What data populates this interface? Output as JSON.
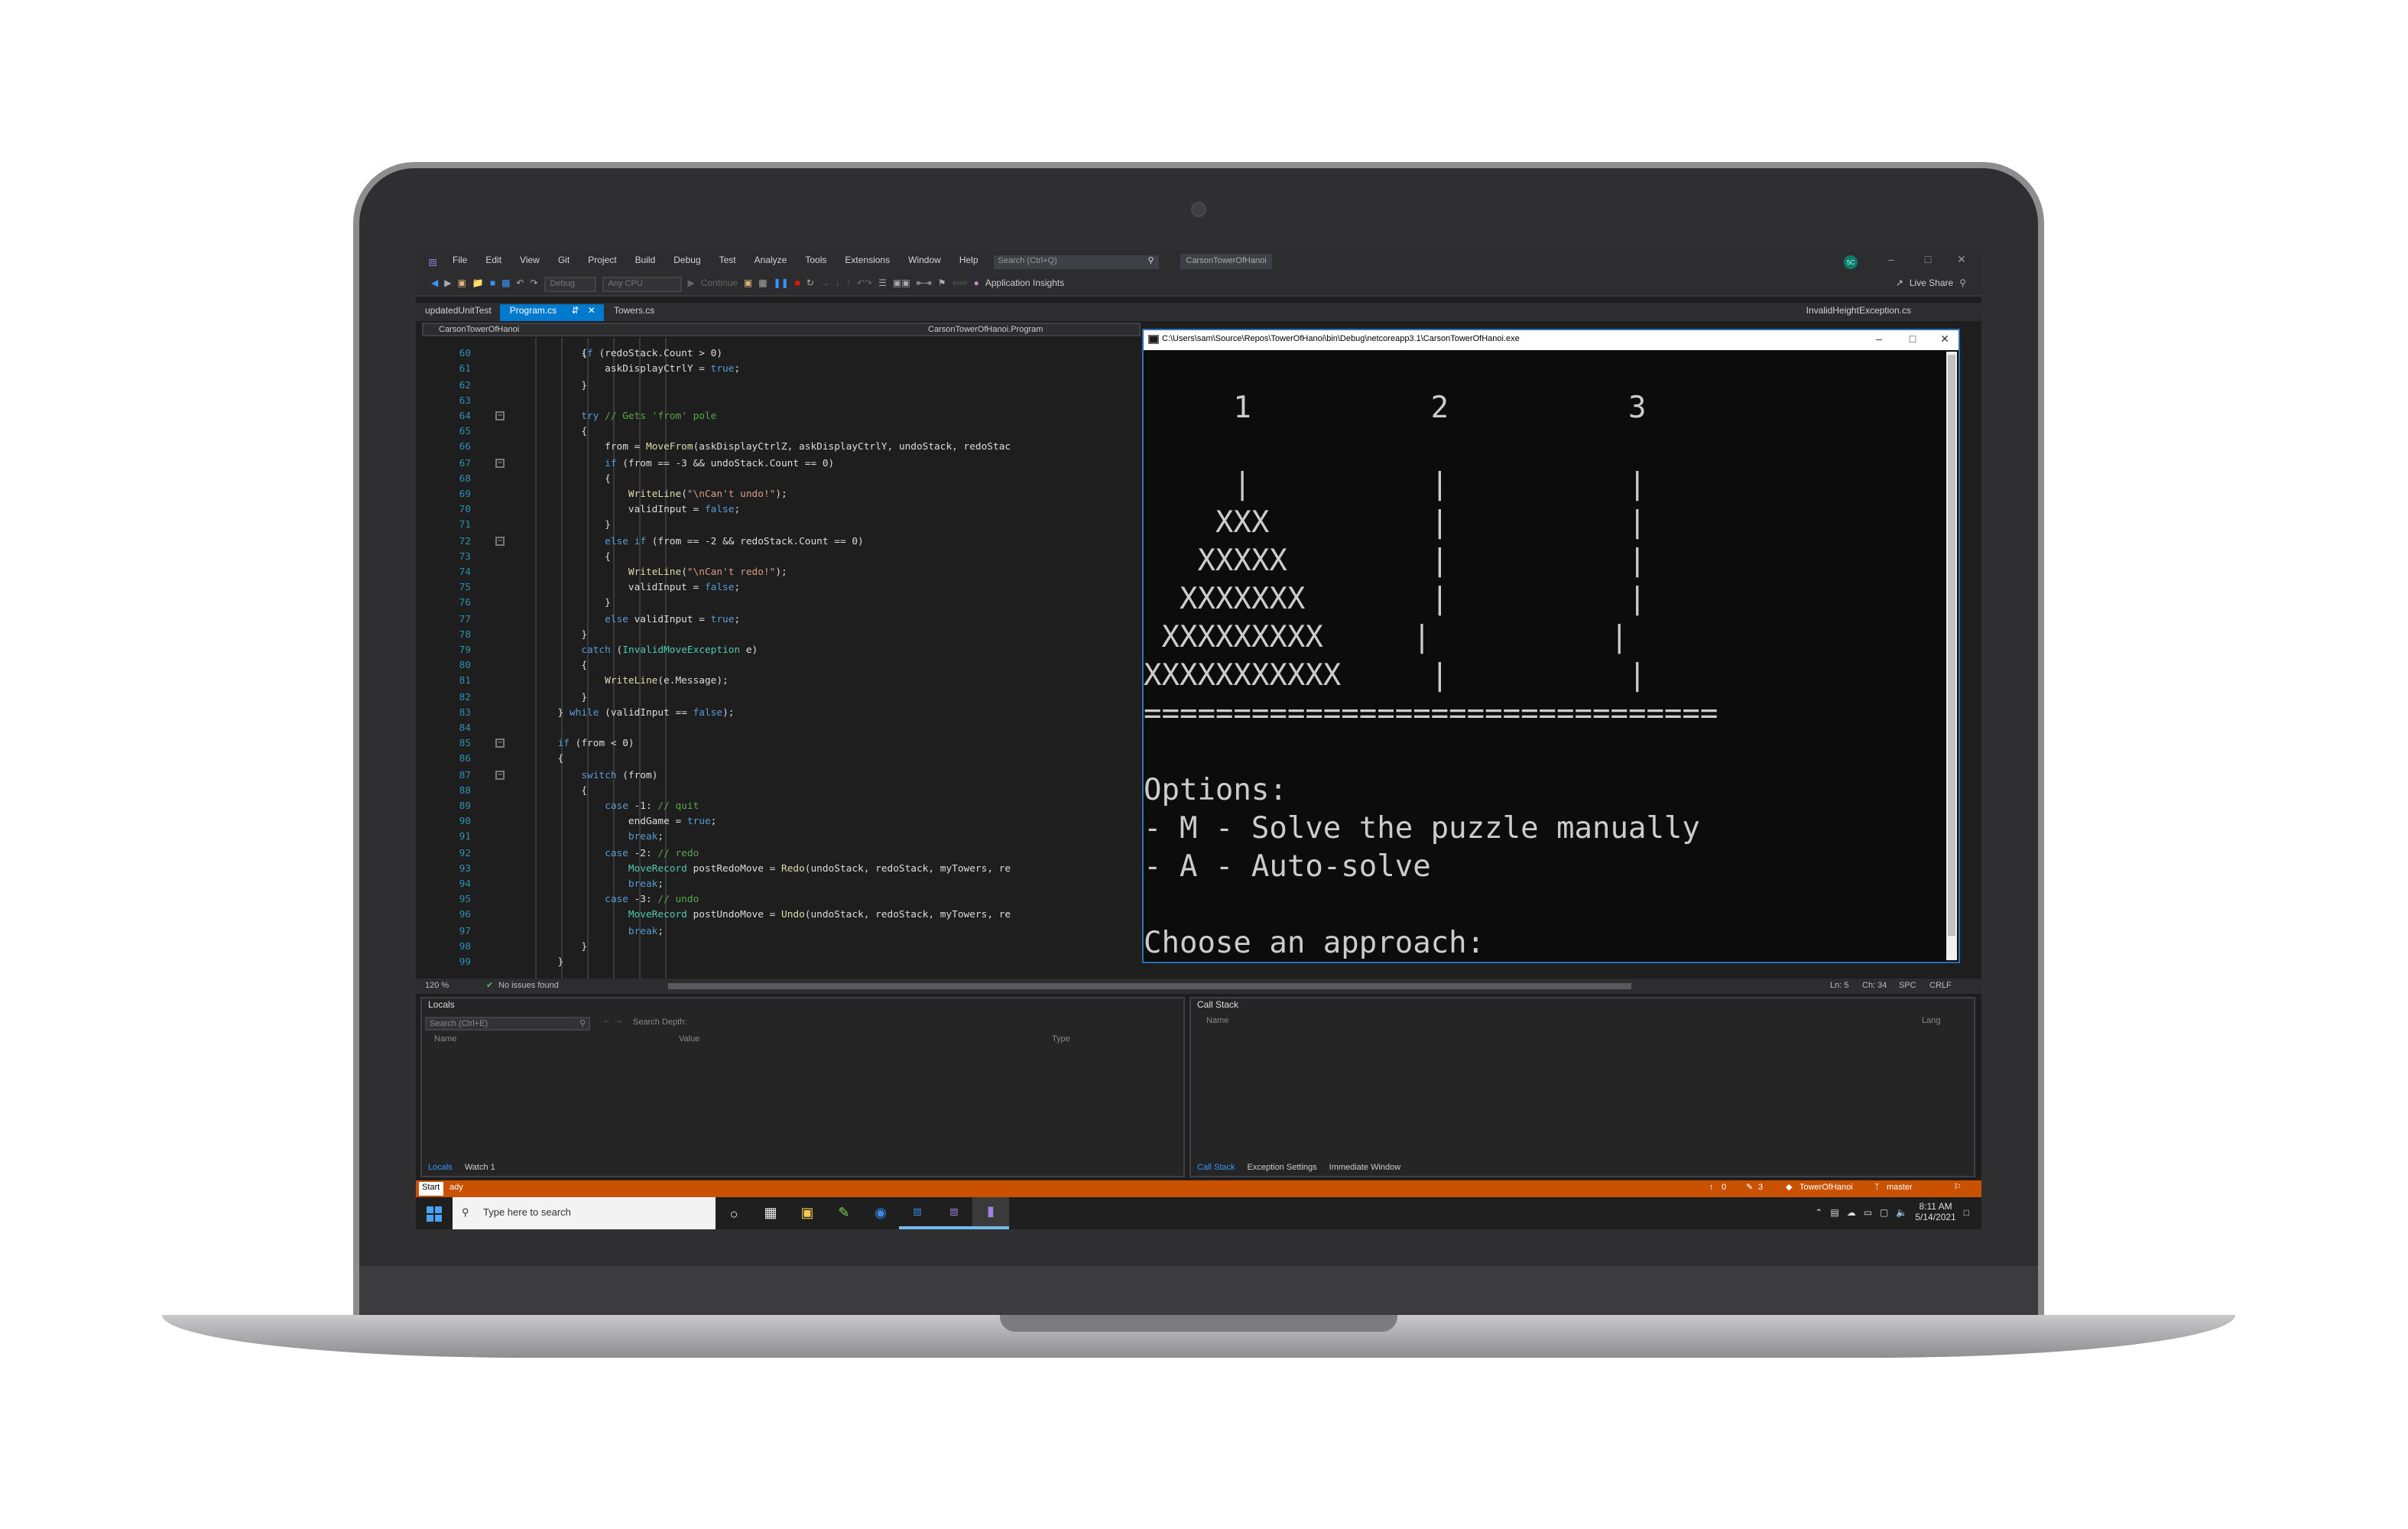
{
  "menubar": {
    "items": [
      "File",
      "Edit",
      "View",
      "Git",
      "Project",
      "Build",
      "Debug",
      "Test",
      "Analyze",
      "Tools",
      "Extensions",
      "Window",
      "Help"
    ],
    "search_placeholder": "Search (Ctrl+Q)",
    "solution_name": "CarsonTowerOfHanoi",
    "avatar_initials": "SC"
  },
  "toolbar": {
    "config_value": "Debug",
    "platform_value": "Any CPU",
    "continue_label": "Continue",
    "app_insights_label": "Application Insights",
    "live_share_label": "Live Share"
  },
  "tabs": [
    "updatedUnitTest",
    "Program.cs",
    "Towers.cs"
  ],
  "right_tab": "InvalidHeightException.cs",
  "navbar": {
    "project": "CarsonTowerOfHanoi",
    "class": "CarsonTowerOfHanoi.Program"
  },
  "code_lines": [
    {
      "n": "60",
      "t": "            {"
    },
    {
      "n": "61",
      "t": "                askDisplayCtrlY = true;"
    },
    {
      "n": "62",
      "t": "            }"
    },
    {
      "n": "63",
      "t": ""
    },
    {
      "n": "64",
      "t": "            try // Gets 'from' pole"
    },
    {
      "n": "65",
      "t": "            {"
    },
    {
      "n": "66",
      "t": "                from = MoveFrom(askDisplayCtrlZ, askDisplayCtrlY, undoStack, redoStac"
    },
    {
      "n": "67",
      "t": "                if (from == -3 && undoStack.Count == 0)"
    },
    {
      "n": "68",
      "t": "                {"
    },
    {
      "n": "69",
      "t": "                    WriteLine(\"\\nCan't undo!\");"
    },
    {
      "n": "70",
      "t": "                    validInput = false;"
    },
    {
      "n": "71",
      "t": "                }"
    },
    {
      "n": "72",
      "t": "                else if (from == -2 && redoStack.Count == 0)"
    },
    {
      "n": "73",
      "t": "                {"
    },
    {
      "n": "74",
      "t": "                    WriteLine(\"\\nCan't redo!\");"
    },
    {
      "n": "75",
      "t": "                    validInput = false;"
    },
    {
      "n": "76",
      "t": "                }"
    },
    {
      "n": "77",
      "t": "                else validInput = true;"
    },
    {
      "n": "78",
      "t": "            }"
    },
    {
      "n": "79",
      "t": "            catch (InvalidMoveException e)"
    },
    {
      "n": "80",
      "t": "            {"
    },
    {
      "n": "81",
      "t": "                WriteLine(e.Message);"
    },
    {
      "n": "82",
      "t": "            }"
    },
    {
      "n": "83",
      "t": "        } while (validInput == false);"
    },
    {
      "n": "84",
      "t": ""
    },
    {
      "n": "85",
      "t": "        if (from < 0)"
    },
    {
      "n": "86",
      "t": "        {"
    },
    {
      "n": "87",
      "t": "            switch (from)"
    },
    {
      "n": "88",
      "t": "            {"
    },
    {
      "n": "89",
      "t": "                case -1: // quit"
    },
    {
      "n": "90",
      "t": "                    endGame = true;"
    },
    {
      "n": "91",
      "t": "                    break;"
    },
    {
      "n": "92",
      "t": "                case -2: // redo"
    },
    {
      "n": "93",
      "t": "                    MoveRecord postRedoMove = Redo(undoStack, redoStack, myTowers, re"
    },
    {
      "n": "94",
      "t": "                    break;"
    },
    {
      "n": "95",
      "t": "                case -3: // undo"
    },
    {
      "n": "96",
      "t": "                    MoveRecord postUndoMove = Undo(undoStack, redoStack, myTowers, re"
    },
    {
      "n": "97",
      "t": "                    break;"
    },
    {
      "n": "98",
      "t": "            }"
    },
    {
      "n": "99",
      "t": "        }"
    }
  ],
  "top_partial_line": "            if (redoStack.Count > 0)",
  "console": {
    "title": "C:\\Users\\sam\\Source\\Repos\\TowerOfHanoi\\bin\\Debug\\netcoreapp3.1\\CarsonTowerOfHanoi.exe",
    "lines": [
      "",
      "     1          2          3",
      "",
      "     |          |          |",
      "    XXX         |          |",
      "   XXXXX        |          |",
      "  XXXXXXX       |          |",
      " XXXXXXXXX     |          |",
      "XXXXXXXXXXX     |          |",
      "================================",
      "",
      "Options:",
      "- M - Solve the puzzle manually",
      "- A - Auto-solve",
      "",
      "Choose an approach:"
    ]
  },
  "editor_status": {
    "zoom": "120 %",
    "issues": "No issues found",
    "line": "Ln: 5",
    "col": "Ch: 34",
    "spc": "SPC",
    "crlf": "CRLF"
  },
  "locals_panel": {
    "title": "Locals",
    "search_placeholder": "Search (Ctrl+E)",
    "search_depth_label": "Search Depth:",
    "columns": [
      "Name",
      "Value",
      "Type"
    ],
    "tabs": [
      "Locals",
      "Watch 1"
    ]
  },
  "callstack_panel": {
    "title": "Call Stack",
    "columns": [
      "Name",
      "Lang"
    ],
    "tabs": [
      "Call Stack",
      "Exception Settings",
      "Immediate Window"
    ]
  },
  "statusbar": {
    "tooltip": "Start",
    "text": "ady",
    "errors": "0",
    "changes": "3",
    "repo": "TowerOfHanoi",
    "branch": "master"
  },
  "taskbar": {
    "search_placeholder": "Type here to search",
    "time": "8:11 AM",
    "date": "5/14/2021"
  },
  "colors": {
    "accent": "#007acc",
    "status": "#ca5100",
    "console_bg": "#0c0c0c",
    "editor_bg": "#1e1e1e"
  }
}
